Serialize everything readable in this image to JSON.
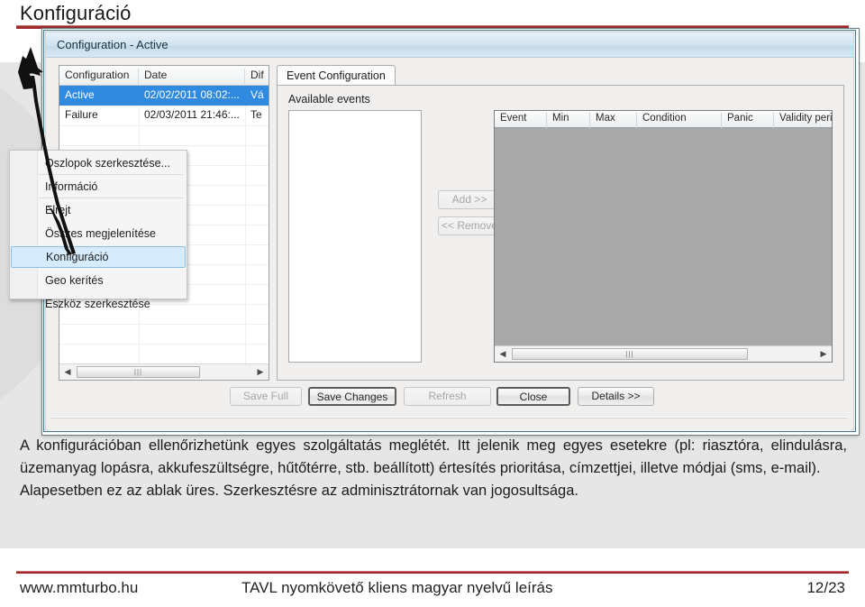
{
  "slide": {
    "title": "Konfiguráció",
    "accent_color": "#9c2a2a",
    "background_color": "#e6e6e6"
  },
  "footer": {
    "url": "www.mmturbo.hu",
    "document_title": "TAVL nyomkövető kliens magyar nyelvű leírás",
    "page": "12/23"
  },
  "body_text": {
    "paragraph1": "A konfigurációban ellenőrizhetünk egyes szolgáltatás meglétét. Itt jelenik meg egyes esetekre (pl: riasztóra, elindulásra, üzemanyag lopásra, akkufeszültségre, hűtőtérre, stb. beállított) értesítés prioritása, címzettjei, illetve módjai (sms, e-mail).",
    "paragraph2": "Alapesetben ez az ablak üres. Szerkesztésre az adminisztrátornak van jogosultsága."
  },
  "window": {
    "title": "Configuration - Active",
    "left_grid": {
      "columns": [
        "Configuration",
        "Date",
        "Dif"
      ],
      "rows": [
        {
          "configuration": "Active",
          "date": "02/02/2011 08:02:...",
          "dif": "Vá",
          "selected": true
        },
        {
          "configuration": "Failure",
          "date": "02/03/2011 21:46:...",
          "dif": "Te",
          "selected": false
        }
      ],
      "scrollbar": {
        "left_arrow": "◀",
        "right_arrow": "▶",
        "grip": "|||"
      }
    },
    "tab": {
      "label": "Event Configuration",
      "available_events_label": "Available events",
      "available_events_items": [],
      "add_button": "Add >>",
      "remove_button": "<< Remove",
      "events_table": {
        "columns": [
          "Event",
          "Min",
          "Max",
          "Condition",
          "Panic",
          "Validity period"
        ],
        "rows": []
      },
      "scrollbar": {
        "left_arrow": "◀",
        "right_arrow": "▶",
        "grip": "|||"
      }
    },
    "buttons": [
      {
        "label": "Save Full",
        "state": "disabled"
      },
      {
        "label": "Save Changes",
        "state": "default"
      },
      {
        "label": "Refresh",
        "state": "disabled"
      },
      {
        "label": "Close",
        "state": "default"
      },
      {
        "label": "Details >>",
        "state": "normal"
      }
    ]
  },
  "context_menu": {
    "items": [
      {
        "label": "Oszlopok szerkesztése...",
        "selected": false,
        "separator_after": true
      },
      {
        "label": "Információ",
        "selected": false,
        "separator_after": true
      },
      {
        "label": "Elrejt",
        "selected": false,
        "separator_after": false
      },
      {
        "label": "Összes megjelenítése",
        "selected": false,
        "separator_after": false
      },
      {
        "label": "Konfiguráció",
        "selected": true,
        "separator_after": false
      },
      {
        "label": "Geo kerítés",
        "selected": false,
        "separator_after": false
      },
      {
        "label": "Eszköz szerkesztése",
        "selected": false,
        "separator_after": false
      }
    ],
    "highlight_color": "#d6ebfb"
  }
}
